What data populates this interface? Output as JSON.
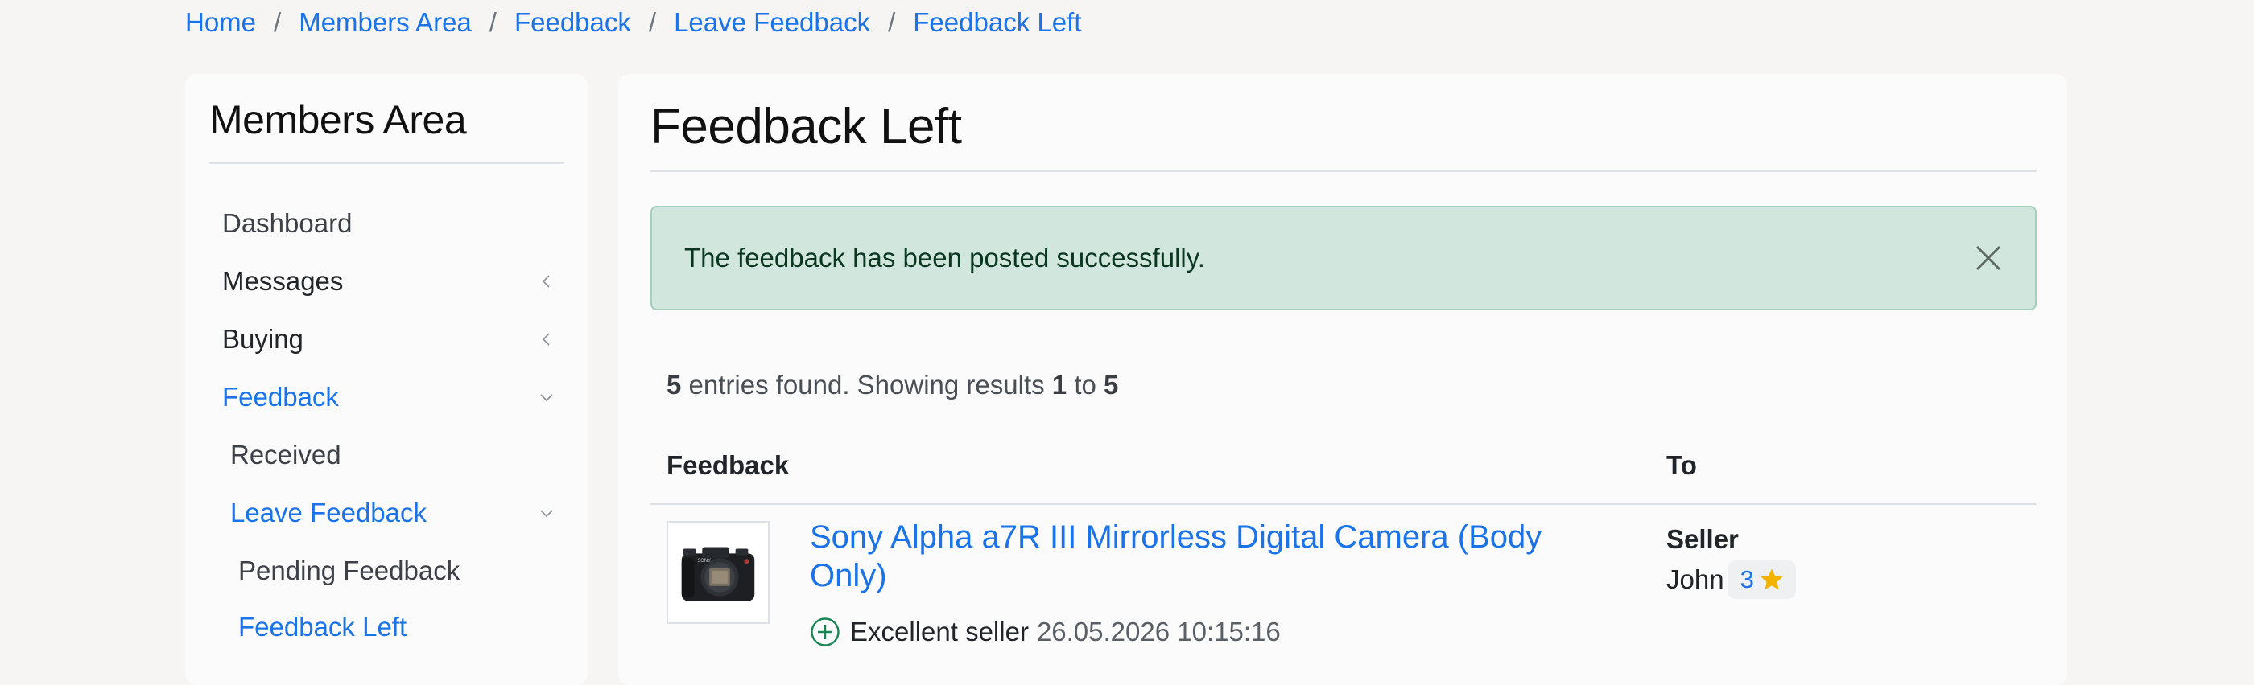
{
  "breadcrumb": {
    "items": [
      "Home",
      "Members Area",
      "Feedback",
      "Leave Feedback",
      "Feedback Left"
    ],
    "separator": "/"
  },
  "sidebar": {
    "title": "Members Area",
    "items": [
      {
        "label": "Dashboard",
        "state": "default",
        "chevron": "none"
      },
      {
        "label": "Messages",
        "state": "default",
        "chevron": "left"
      },
      {
        "label": "Buying",
        "state": "default",
        "chevron": "left"
      },
      {
        "label": "Feedback",
        "state": "active",
        "chevron": "down"
      },
      {
        "label": "Received",
        "state": "default",
        "chevron": "none"
      },
      {
        "label": "Leave Feedback",
        "state": "active",
        "chevron": "down"
      },
      {
        "label": "Pending Feedback",
        "state": "default",
        "chevron": "none"
      },
      {
        "label": "Feedback Left",
        "state": "active",
        "chevron": "none"
      }
    ]
  },
  "main": {
    "title": "Feedback Left",
    "alert": {
      "message": "The feedback has been posted successfully.",
      "close_icon": "close-icon"
    },
    "results": {
      "count": "5",
      "text_1": "entries found. Showing results",
      "from": "1",
      "text_2": "to",
      "to": "5"
    },
    "table": {
      "headers": {
        "feedback": "Feedback",
        "to": "To"
      },
      "rows": [
        {
          "product_title": "Sony Alpha a7R III Mirrorless Digital Camera (Body Only)",
          "thumbnail": "camera-image",
          "rating_type_icon": "plus-circle-icon",
          "comment": "Excellent seller",
          "date": "26.05.2026 10:15:16",
          "role": "Seller",
          "username": "John",
          "user_score": "3"
        }
      ]
    }
  },
  "colors": {
    "link": "#1a73e8",
    "alert_bg": "#d1e7dd",
    "alert_border": "#a3cfbb",
    "positive": "#198754",
    "star": "#f5b301",
    "page_bg": "#f6f5f3"
  }
}
